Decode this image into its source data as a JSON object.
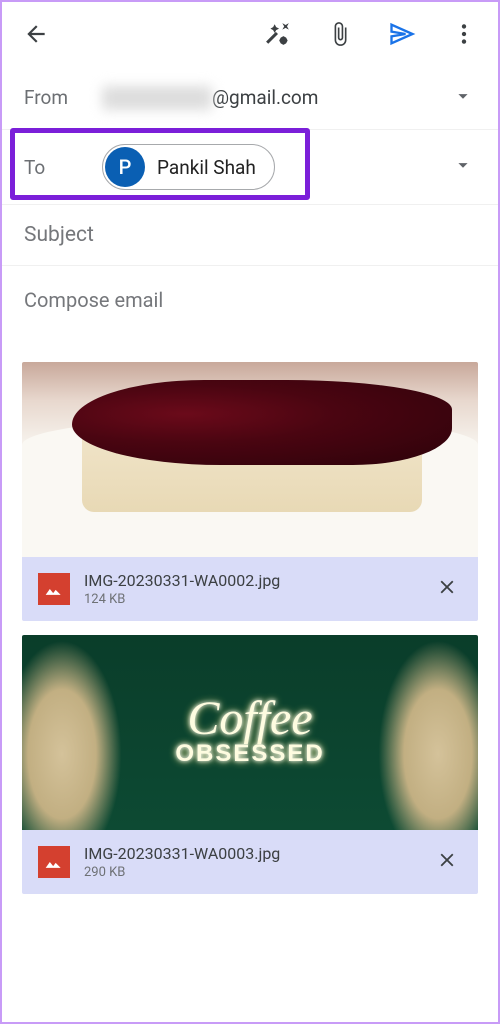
{
  "from": {
    "label": "From",
    "domain": "@gmail.com"
  },
  "to": {
    "label": "To",
    "chip": {
      "initial": "P",
      "name": "Pankil Shah"
    }
  },
  "subject": {
    "placeholder": "Subject"
  },
  "compose": {
    "placeholder": "Compose email"
  },
  "attachments": [
    {
      "filename": "IMG-20230331-WA0002.jpg",
      "size": "124 KB"
    },
    {
      "filename": "IMG-20230331-WA0003.jpg",
      "size": "290 KB"
    }
  ]
}
